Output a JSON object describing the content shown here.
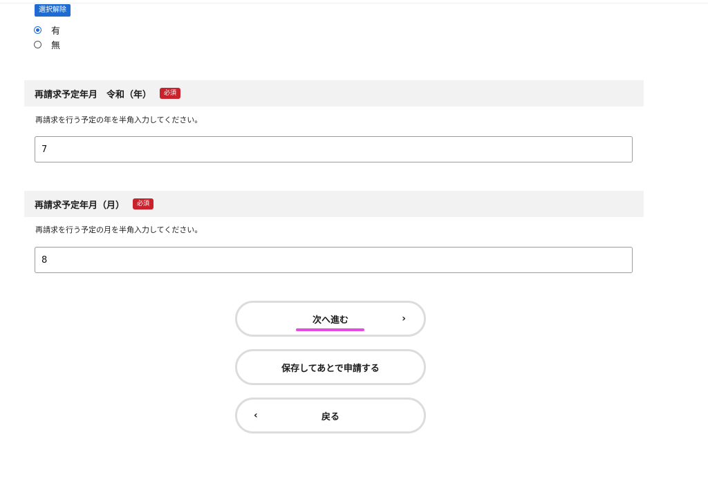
{
  "deselect_label": "選択解除",
  "radio_options": [
    {
      "label": "有",
      "checked": true
    },
    {
      "label": "無",
      "checked": false
    }
  ],
  "year_section": {
    "title": "再請求予定年月　令和（年）",
    "required_label": "必須",
    "help": "再請求を行う予定の年を半角入力してください。",
    "value": "7"
  },
  "month_section": {
    "title": "再請求予定年月（月）",
    "required_label": "必須",
    "help": "再請求を行う予定の月を半角入力してください。",
    "value": "8"
  },
  "buttons": {
    "next_label": "次へ進む",
    "next_icon": "chevron-right-icon",
    "save_label": "保存してあとで申請する",
    "back_label": "戻る",
    "back_icon": "chevron-left-icon"
  },
  "colors": {
    "primary": "#1f6bd1",
    "required": "#c8222d",
    "highlight": "#e54be0",
    "section_bg": "#f2f2f2"
  }
}
